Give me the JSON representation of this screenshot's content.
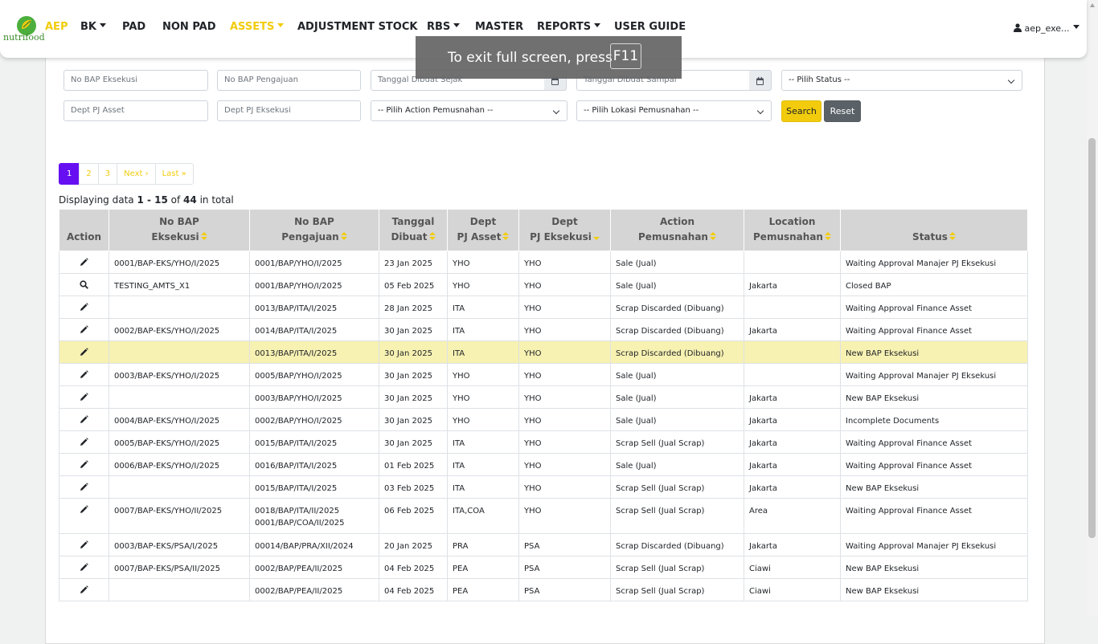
{
  "navbar": {
    "brand": "nutrifood",
    "items": [
      {
        "label": "AEP",
        "active": true,
        "dropdown": false
      },
      {
        "label": "BK",
        "active": false,
        "dropdown": true
      },
      {
        "label": "PAD",
        "active": false,
        "dropdown": false
      },
      {
        "label": "NON PAD",
        "active": false,
        "dropdown": false
      },
      {
        "label": "ASSETS",
        "active": true,
        "dropdown": true
      },
      {
        "label": "ADJUSTMENT STOCK",
        "active": false,
        "dropdown": false
      },
      {
        "label": "RBS",
        "active": false,
        "dropdown": true
      },
      {
        "label": "MASTER",
        "active": false,
        "dropdown": false
      },
      {
        "label": "REPORTS",
        "active": false,
        "dropdown": true
      },
      {
        "label": "USER GUIDE",
        "active": false,
        "dropdown": false
      }
    ],
    "user": "aep_exe..."
  },
  "fullscreen_toast": {
    "message": "To exit full screen, press",
    "key": "F11"
  },
  "filters": {
    "no_bap_eksekusi": "No BAP Eksekusi",
    "no_bap_pengajuan": "No BAP Pengajuan",
    "tanggal_dibuat_sejak": "Tanggal Dibuat Sejak",
    "tanggal_dibuat_sampai": "Tanggal Dibuat Sampai",
    "status": "-- Pilih Status --",
    "dept_pj_asset": "Dept PJ Asset",
    "dept_pj_eksekusi": "Dept PJ Eksekusi",
    "action_pemusnahan": "-- Pilih Action Pemusnahan --",
    "lokasi_pemusnahan": "-- Pilih Lokasi Pemusnahan --",
    "search_label": "Search",
    "reset_label": "Reset"
  },
  "pagination": {
    "pages": [
      "1",
      "2",
      "3"
    ],
    "active": "1",
    "next": "Next ›",
    "last": "Last »"
  },
  "summary": {
    "prefix": "Displaying data ",
    "range": "1 - 15",
    "of": " of ",
    "total": "44",
    "suffix": " in total"
  },
  "colors": {
    "accent": "#f2cc0c",
    "active_page": "#6610f2",
    "highlight_row": "#f7f1b2"
  },
  "table": {
    "headers": [
      {
        "line1": "",
        "line2": "Action",
        "sort": "none"
      },
      {
        "line1": "No BAP",
        "line2": "Eksekusi",
        "sort": "both"
      },
      {
        "line1": "No BAP",
        "line2": "Pengajuan",
        "sort": "both"
      },
      {
        "line1": "Tanggal",
        "line2": "Dibuat",
        "sort": "both"
      },
      {
        "line1": "Dept",
        "line2": "PJ Asset",
        "sort": "both"
      },
      {
        "line1": "Dept",
        "line2": "PJ Eksekusi",
        "sort": "desc"
      },
      {
        "line1": "Action",
        "line2": "Pemusnahan",
        "sort": "both"
      },
      {
        "line1": "Location",
        "line2": "Pemusnahan",
        "sort": "both"
      },
      {
        "line1": "",
        "line2": "Status",
        "sort": "both"
      }
    ],
    "rows": [
      {
        "icon": "edit",
        "eksekusi": "0001/BAP-EKS/YHO/I/2025",
        "pengajuan": "0001/BAP/YHO/I/2025",
        "tanggal": "23 Jan 2025",
        "pj_asset": "YHO",
        "pj_eksekusi": "YHO",
        "action": "Sale (Jual)",
        "location": "",
        "status": "Waiting Approval Manajer PJ Eksekusi",
        "highlight": false
      },
      {
        "icon": "view",
        "eksekusi": "TESTING_AMTS_X1",
        "pengajuan": "0001/BAP/YHO/I/2025",
        "tanggal": "05 Feb 2025",
        "pj_asset": "YHO",
        "pj_eksekusi": "YHO",
        "action": "Sale (Jual)",
        "location": "Jakarta",
        "status": "Closed BAP",
        "highlight": false
      },
      {
        "icon": "edit",
        "eksekusi": "",
        "pengajuan": "0013/BAP/ITA/I/2025",
        "tanggal": "28 Jan 2025",
        "pj_asset": "ITA",
        "pj_eksekusi": "YHO",
        "action": "Scrap Discarded (Dibuang)",
        "location": "",
        "status": "Waiting Approval Finance Asset",
        "highlight": false
      },
      {
        "icon": "edit",
        "eksekusi": "0002/BAP-EKS/YHO/I/2025",
        "pengajuan": "0014/BAP/ITA/I/2025",
        "tanggal": "30 Jan 2025",
        "pj_asset": "ITA",
        "pj_eksekusi": "YHO",
        "action": "Scrap Discarded (Dibuang)",
        "location": "Jakarta",
        "status": "Waiting Approval Finance Asset",
        "highlight": false
      },
      {
        "icon": "edit",
        "eksekusi": "",
        "pengajuan": "0013/BAP/ITA/I/2025",
        "tanggal": "30 Jan 2025",
        "pj_asset": "ITA",
        "pj_eksekusi": "YHO",
        "action": "Scrap Discarded (Dibuang)",
        "location": "",
        "status": "New BAP Eksekusi",
        "highlight": true
      },
      {
        "icon": "edit",
        "eksekusi": "0003/BAP-EKS/YHO/I/2025",
        "pengajuan": "0005/BAP/YHO/I/2025",
        "tanggal": "30 Jan 2025",
        "pj_asset": "YHO",
        "pj_eksekusi": "YHO",
        "action": "Sale (Jual)",
        "location": "",
        "status": "Waiting Approval Manajer PJ Eksekusi",
        "highlight": false
      },
      {
        "icon": "edit",
        "eksekusi": "",
        "pengajuan": "0003/BAP/YHO/I/2025",
        "tanggal": "30 Jan 2025",
        "pj_asset": "YHO",
        "pj_eksekusi": "YHO",
        "action": "Sale (Jual)",
        "location": "Jakarta",
        "status": "New BAP Eksekusi",
        "highlight": false
      },
      {
        "icon": "edit",
        "eksekusi": "0004/BAP-EKS/YHO/I/2025",
        "pengajuan": "0002/BAP/YHO/I/2025",
        "tanggal": "30 Jan 2025",
        "pj_asset": "YHO",
        "pj_eksekusi": "YHO",
        "action": "Sale (Jual)",
        "location": "Jakarta",
        "status": "Incomplete Documents",
        "highlight": false
      },
      {
        "icon": "edit",
        "eksekusi": "0005/BAP-EKS/YHO/I/2025",
        "pengajuan": "0015/BAP/ITA/I/2025",
        "tanggal": "30 Jan 2025",
        "pj_asset": "ITA",
        "pj_eksekusi": "YHO",
        "action": "Scrap Sell (Jual Scrap)",
        "location": "Jakarta",
        "status": "Waiting Approval Finance Asset",
        "highlight": false
      },
      {
        "icon": "edit",
        "eksekusi": "0006/BAP-EKS/YHO/I/2025",
        "pengajuan": "0016/BAP/ITA/I/2025",
        "tanggal": "01 Feb 2025",
        "pj_asset": "ITA",
        "pj_eksekusi": "YHO",
        "action": "Sale (Jual)",
        "location": "Jakarta",
        "status": "Waiting Approval Finance Asset",
        "highlight": false
      },
      {
        "icon": "edit",
        "eksekusi": "",
        "pengajuan": "0015/BAP/ITA/I/2025",
        "tanggal": "03 Feb 2025",
        "pj_asset": "ITA",
        "pj_eksekusi": "YHO",
        "action": "Scrap Sell (Jual Scrap)",
        "location": "Jakarta",
        "status": "New BAP Eksekusi",
        "highlight": false
      },
      {
        "icon": "edit",
        "eksekusi": "0007/BAP-EKS/YHO/II/2025",
        "pengajuan": "0018/BAP/ITA/II/2025\n0001/BAP/COA/II/2025",
        "tanggal": "06 Feb 2025",
        "pj_asset": "ITA,COA",
        "pj_eksekusi": "YHO",
        "action": "Scrap Sell (Jual Scrap)",
        "location": "Area",
        "status": "Waiting Approval Finance Asset",
        "highlight": false
      },
      {
        "icon": "edit",
        "eksekusi": "0003/BAP-EKS/PSA/I/2025",
        "pengajuan": "00014/BAP/PRA/XII/2024",
        "tanggal": "20 Jan 2025",
        "pj_asset": "PRA",
        "pj_eksekusi": "PSA",
        "action": "Scrap Discarded (Dibuang)",
        "location": "Jakarta",
        "status": "Waiting Approval Manajer PJ Eksekusi",
        "highlight": false
      },
      {
        "icon": "edit",
        "eksekusi": "0007/BAP-EKS/PSA/II/2025",
        "pengajuan": "0002/BAP/PEA/II/2025",
        "tanggal": "04 Feb 2025",
        "pj_asset": "PEA",
        "pj_eksekusi": "PSA",
        "action": "Scrap Sell (Jual Scrap)",
        "location": "Ciawi",
        "status": "New BAP Eksekusi",
        "highlight": false
      },
      {
        "icon": "edit",
        "eksekusi": "",
        "pengajuan": "0002/BAP/PEA/II/2025",
        "tanggal": "04 Feb 2025",
        "pj_asset": "PEA",
        "pj_eksekusi": "PSA",
        "action": "Scrap Sell (Jual Scrap)",
        "location": "Ciawi",
        "status": "New BAP Eksekusi",
        "highlight": false
      }
    ]
  }
}
